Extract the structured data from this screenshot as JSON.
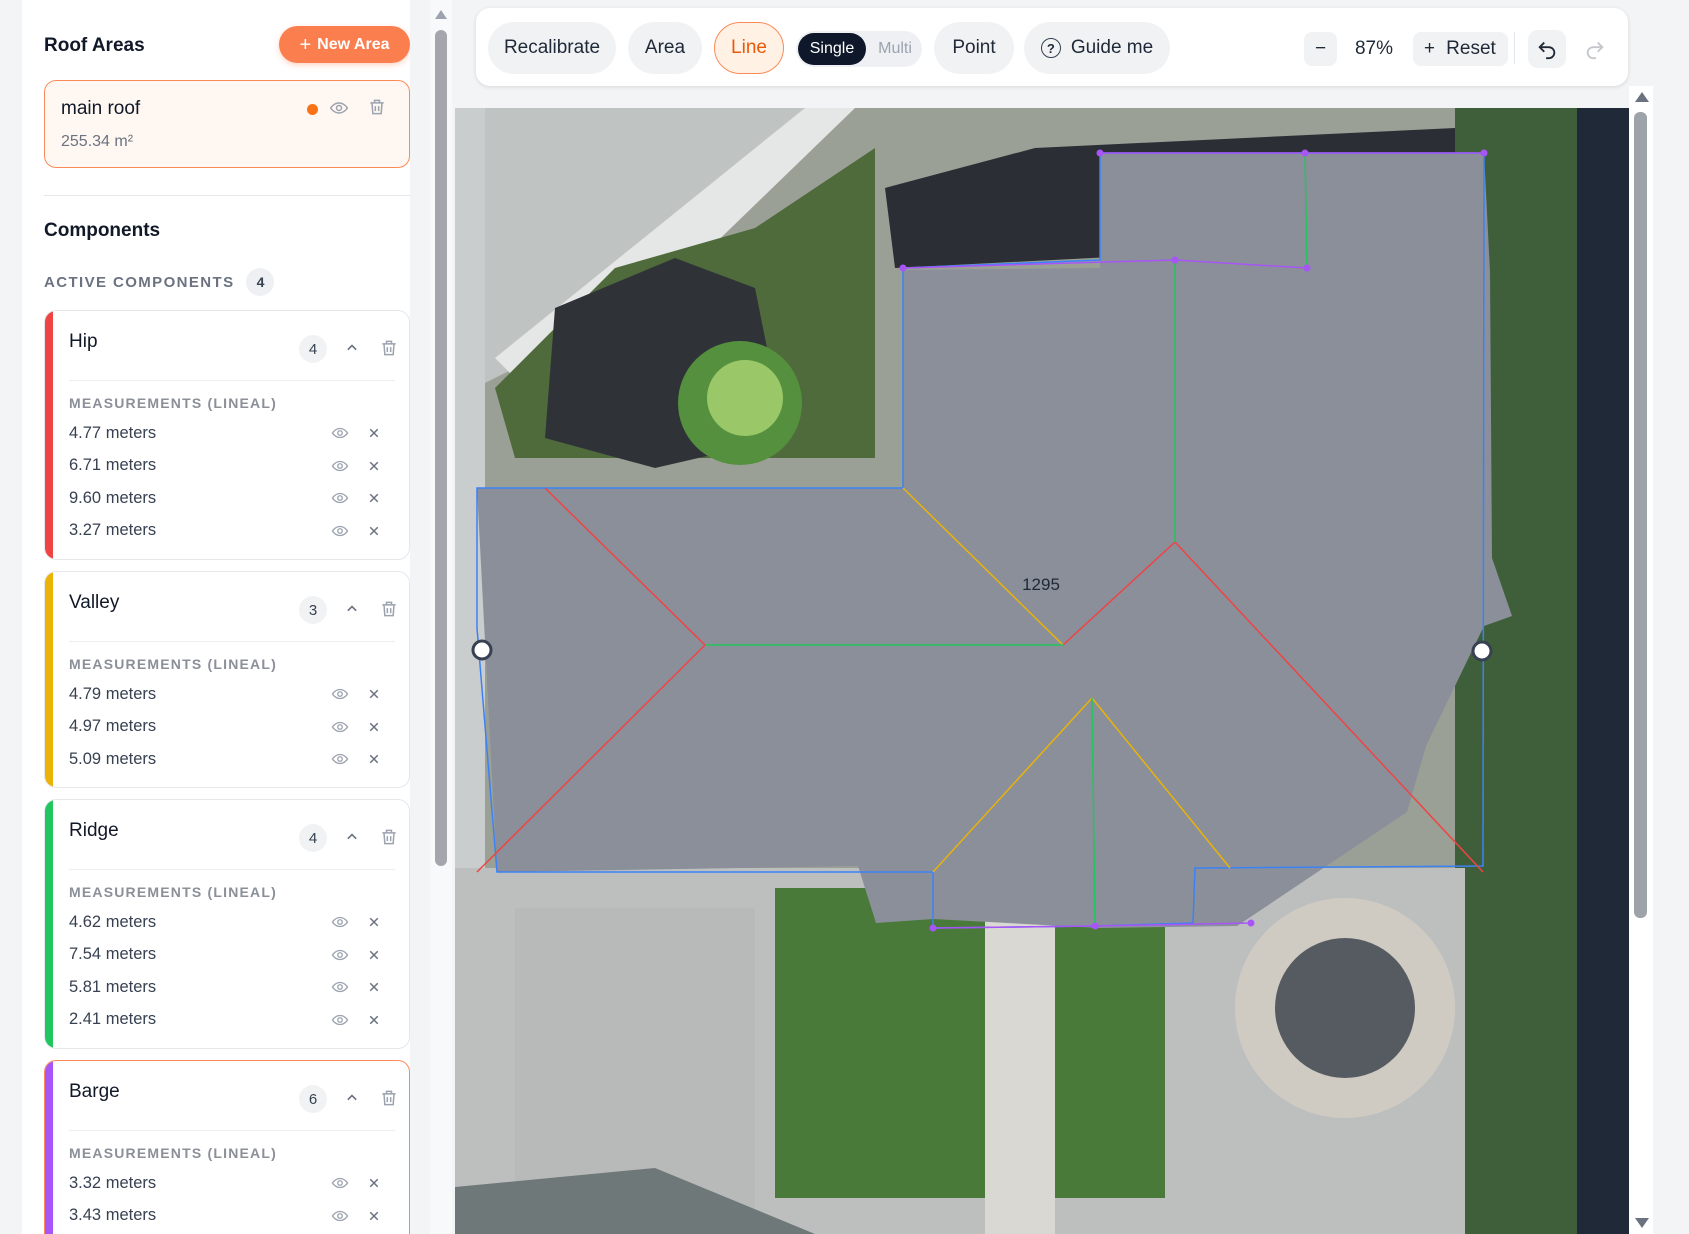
{
  "sidebar": {
    "title": "Roof Areas",
    "new_area_icon": "plus-icon",
    "new_area_label": "New Area",
    "area": {
      "name": "main roof",
      "size": "255.34 m²",
      "status_color": "#f97316"
    },
    "components_title": "Components",
    "active_label": "ACTIVE COMPONENTS",
    "active_count": "4",
    "measurements_label": "MEASUREMENTS (LINEAL)",
    "components": [
      {
        "name": "Hip",
        "count": "4",
        "color": "#ef4444",
        "measurements": [
          "4.77 meters",
          "6.71 meters",
          "9.60 meters",
          "3.27 meters"
        ]
      },
      {
        "name": "Valley",
        "count": "3",
        "color": "#eab308",
        "measurements": [
          "4.79 meters",
          "4.97 meters",
          "5.09 meters"
        ]
      },
      {
        "name": "Ridge",
        "count": "4",
        "color": "#22c55e",
        "measurements": [
          "4.62 meters",
          "7.54 meters",
          "5.81 meters",
          "2.41 meters"
        ]
      },
      {
        "name": "Barge",
        "count": "6",
        "color": "#a855f7",
        "measurements": [
          "3.32 meters",
          "3.43 meters"
        ]
      }
    ]
  },
  "toolbar": {
    "recalibrate": "Recalibrate",
    "area": "Area",
    "line": "Line",
    "single": "Single",
    "multi": "Multi",
    "point": "Point",
    "guide": "Guide me",
    "zoom_out": "−",
    "zoom": "87%",
    "zoom_in": "+",
    "reset": "Reset"
  },
  "canvas": {
    "area_label": "1295",
    "colors": {
      "outline": "#3b82f6",
      "hip": "#ef4444",
      "valley": "#eab308",
      "ridge": "#22c55e",
      "barge": "#a855f7"
    }
  }
}
